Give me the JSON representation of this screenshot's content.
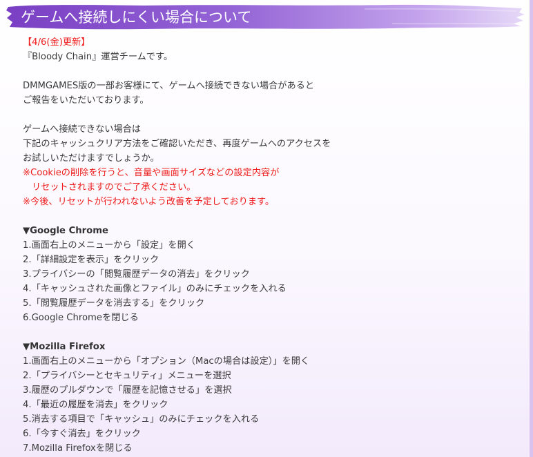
{
  "title": "ゲームへ接続しにくい場合について",
  "update_date": "【4/6(金)更新】",
  "intro_lines": [
    "『Bloody Chain』運営チームです。",
    "DMMGAMES版の一部お客様にて、ゲームへ接続できない場合があると",
    "ご報告をいただいております。",
    "ゲームへ接続できない場合は",
    "下記のキャッシュクリア方法をご確認いただき、再度ゲームへのアクセスを",
    "お試しいただけますでしょうか。"
  ],
  "notes": [
    "※Cookieの削除を行うと、音量や画面サイズなどの設定内容が",
    "リセットされますのでご了承ください。",
    "※今後、リセットが行われないよう改善を予定しております。"
  ],
  "chrome": {
    "heading": "▼Google Chrome",
    "steps": [
      "1.画面右上のメニューから「設定」を開く",
      "2.「詳細設定を表示」をクリック",
      "3.プライバシーの「閲覧履歴データの消去」をクリック",
      "4.「キャッシュされた画像とファイル」のみにチェックを入れる",
      "5.「閲覧履歴データを消去する」をクリック",
      "6.Google Chromeを閉じる"
    ]
  },
  "firefox": {
    "heading": "▼Mozilla Firefox",
    "steps": [
      "1.画面右上のメニューから「オプション（Macの場合は設定）」を開く",
      "2.「プライバシーとセキュリティ」メニューを選択",
      "3.履歴のプルダウンで「履歴を記憶させる」を選択",
      "4.「最近の履歴を消去」をクリック",
      "5.消去する項目で「キャッシュ」のみにチェックを入れる",
      "6.「今すぐ消去」をクリック",
      "7.Mozilla Firefoxを閉じる"
    ]
  },
  "colors": {
    "banner_start": "#7a3fc4",
    "banner_end": "#c9a6ee",
    "notice_red": "#ee1c1c",
    "body_text": "#3a3a3a"
  }
}
